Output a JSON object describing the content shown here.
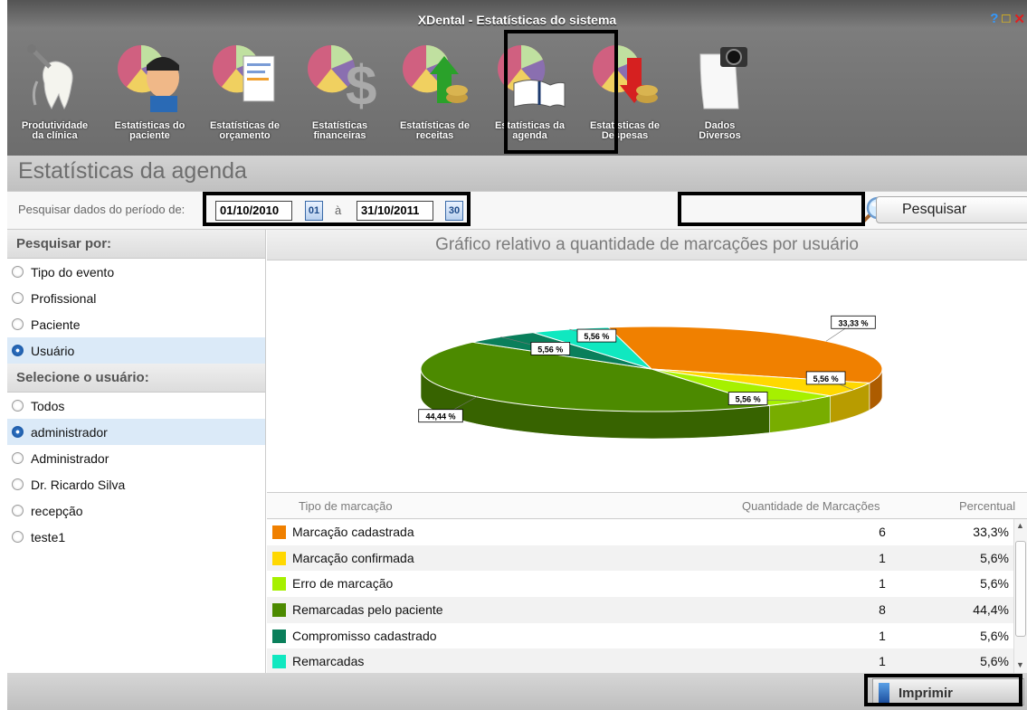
{
  "window": {
    "title": "XDental - Estatísticas do sistema"
  },
  "toolbar": {
    "items": [
      {
        "line1": "Produtividade",
        "line2": "da clínica",
        "icon": "tooth-dental-tools-icon"
      },
      {
        "line1": "Estatísticas do",
        "line2": "paciente",
        "icon": "patient-pie-chart-icon"
      },
      {
        "line1": "Estatísticas de",
        "line2": "orçamento",
        "icon": "budget-pie-chart-icon"
      },
      {
        "line1": "Estatísticas",
        "line2": "financeiras",
        "icon": "dollar-pie-chart-icon"
      },
      {
        "line1": "Estatísticas de",
        "line2": "receitas",
        "icon": "revenue-pie-chart-icon"
      },
      {
        "line1": "Estatísticas da",
        "line2": "agenda",
        "icon": "agenda-book-pie-chart-icon"
      },
      {
        "line1": "Estatísticas de",
        "line2": "Despesas",
        "icon": "expense-pie-chart-icon"
      },
      {
        "line1": "Dados",
        "line2": "Diversos",
        "icon": "camera-document-icon"
      }
    ]
  },
  "page": {
    "title": "Estatísticas da agenda"
  },
  "search": {
    "label": "Pesquisar dados do período de:",
    "date_from": "01/10/2010",
    "date_from_btn": "01",
    "separator": "à",
    "date_to": "31/10/2011",
    "date_to_btn": "30",
    "button": "Pesquisar"
  },
  "filter": {
    "header": "Pesquisar por:",
    "options": [
      "Tipo do evento",
      "Profissional",
      "Paciente",
      "Usuário"
    ],
    "selected": 3
  },
  "users": {
    "header": "Selecione o usuário:",
    "options": [
      "Todos",
      "administrador",
      "Administrador",
      "Dr. Ricardo Silva",
      "recepção",
      "teste1"
    ],
    "selected": 1
  },
  "chart": {
    "title": "Gráfico relativo a quantidade de marcações por usuário"
  },
  "chart_data": {
    "type": "pie",
    "title": "Gráfico relativo a quantidade de marcações por usuário",
    "categories": [
      "Marcação cadastrada",
      "Marcação confirmada",
      "Erro de marcação",
      "Remarcadas pelo paciente",
      "Compromisso cadastrado",
      "Remarcadas"
    ],
    "values": [
      33.33,
      5.56,
      5.56,
      44.44,
      5.56,
      5.56
    ],
    "labels": [
      "33,33 %",
      "5,56 %",
      "5,56 %",
      "44,44 %",
      "5,56 %",
      "5,56 %"
    ],
    "colors": [
      "#f08000",
      "#ffd800",
      "#a6f000",
      "#4c8a00",
      "#0a7f5b",
      "#10e8c0"
    ]
  },
  "table": {
    "headers": [
      "Tipo de marcação",
      "Quantidade de Marcações",
      "Percentual"
    ],
    "rows": [
      {
        "name": "Marcação cadastrada",
        "qty": "6",
        "pct": "33,3%",
        "color": "#f08000"
      },
      {
        "name": "Marcação confirmada",
        "qty": "1",
        "pct": "5,6%",
        "color": "#ffd800"
      },
      {
        "name": "Erro de marcação",
        "qty": "1",
        "pct": "5,6%",
        "color": "#a6f000"
      },
      {
        "name": "Remarcadas pelo paciente",
        "qty": "8",
        "pct": "44,4%",
        "color": "#4c8a00"
      },
      {
        "name": "Compromisso cadastrado",
        "qty": "1",
        "pct": "5,6%",
        "color": "#0a7f5b"
      },
      {
        "name": "Remarcadas",
        "qty": "1",
        "pct": "5,6%",
        "color": "#10e8c0"
      }
    ]
  },
  "footer": {
    "print_button": "Imprimir"
  }
}
